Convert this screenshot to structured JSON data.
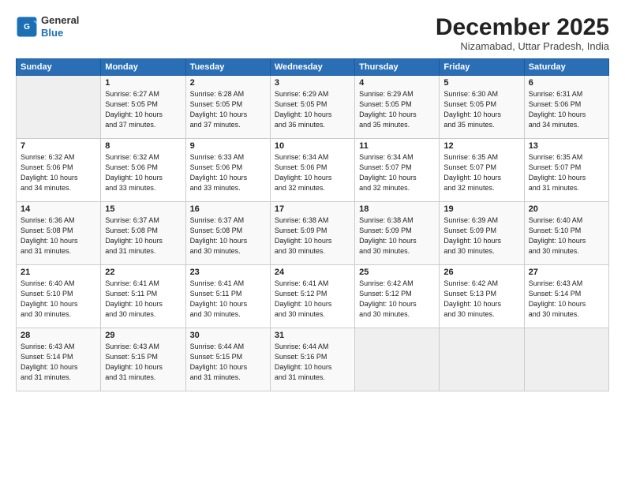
{
  "logo": {
    "line1": "General",
    "line2": "Blue"
  },
  "title": "December 2025",
  "subtitle": "Nizamabad, Uttar Pradesh, India",
  "header_days": [
    "Sunday",
    "Monday",
    "Tuesday",
    "Wednesday",
    "Thursday",
    "Friday",
    "Saturday"
  ],
  "weeks": [
    [
      {
        "day": "",
        "info": ""
      },
      {
        "day": "1",
        "info": "Sunrise: 6:27 AM\nSunset: 5:05 PM\nDaylight: 10 hours\nand 37 minutes."
      },
      {
        "day": "2",
        "info": "Sunrise: 6:28 AM\nSunset: 5:05 PM\nDaylight: 10 hours\nand 37 minutes."
      },
      {
        "day": "3",
        "info": "Sunrise: 6:29 AM\nSunset: 5:05 PM\nDaylight: 10 hours\nand 36 minutes."
      },
      {
        "day": "4",
        "info": "Sunrise: 6:29 AM\nSunset: 5:05 PM\nDaylight: 10 hours\nand 35 minutes."
      },
      {
        "day": "5",
        "info": "Sunrise: 6:30 AM\nSunset: 5:05 PM\nDaylight: 10 hours\nand 35 minutes."
      },
      {
        "day": "6",
        "info": "Sunrise: 6:31 AM\nSunset: 5:06 PM\nDaylight: 10 hours\nand 34 minutes."
      }
    ],
    [
      {
        "day": "7",
        "info": "Sunrise: 6:32 AM\nSunset: 5:06 PM\nDaylight: 10 hours\nand 34 minutes."
      },
      {
        "day": "8",
        "info": "Sunrise: 6:32 AM\nSunset: 5:06 PM\nDaylight: 10 hours\nand 33 minutes."
      },
      {
        "day": "9",
        "info": "Sunrise: 6:33 AM\nSunset: 5:06 PM\nDaylight: 10 hours\nand 33 minutes."
      },
      {
        "day": "10",
        "info": "Sunrise: 6:34 AM\nSunset: 5:06 PM\nDaylight: 10 hours\nand 32 minutes."
      },
      {
        "day": "11",
        "info": "Sunrise: 6:34 AM\nSunset: 5:07 PM\nDaylight: 10 hours\nand 32 minutes."
      },
      {
        "day": "12",
        "info": "Sunrise: 6:35 AM\nSunset: 5:07 PM\nDaylight: 10 hours\nand 32 minutes."
      },
      {
        "day": "13",
        "info": "Sunrise: 6:35 AM\nSunset: 5:07 PM\nDaylight: 10 hours\nand 31 minutes."
      }
    ],
    [
      {
        "day": "14",
        "info": "Sunrise: 6:36 AM\nSunset: 5:08 PM\nDaylight: 10 hours\nand 31 minutes."
      },
      {
        "day": "15",
        "info": "Sunrise: 6:37 AM\nSunset: 5:08 PM\nDaylight: 10 hours\nand 31 minutes."
      },
      {
        "day": "16",
        "info": "Sunrise: 6:37 AM\nSunset: 5:08 PM\nDaylight: 10 hours\nand 30 minutes."
      },
      {
        "day": "17",
        "info": "Sunrise: 6:38 AM\nSunset: 5:09 PM\nDaylight: 10 hours\nand 30 minutes."
      },
      {
        "day": "18",
        "info": "Sunrise: 6:38 AM\nSunset: 5:09 PM\nDaylight: 10 hours\nand 30 minutes."
      },
      {
        "day": "19",
        "info": "Sunrise: 6:39 AM\nSunset: 5:09 PM\nDaylight: 10 hours\nand 30 minutes."
      },
      {
        "day": "20",
        "info": "Sunrise: 6:40 AM\nSunset: 5:10 PM\nDaylight: 10 hours\nand 30 minutes."
      }
    ],
    [
      {
        "day": "21",
        "info": "Sunrise: 6:40 AM\nSunset: 5:10 PM\nDaylight: 10 hours\nand 30 minutes."
      },
      {
        "day": "22",
        "info": "Sunrise: 6:41 AM\nSunset: 5:11 PM\nDaylight: 10 hours\nand 30 minutes."
      },
      {
        "day": "23",
        "info": "Sunrise: 6:41 AM\nSunset: 5:11 PM\nDaylight: 10 hours\nand 30 minutes."
      },
      {
        "day": "24",
        "info": "Sunrise: 6:41 AM\nSunset: 5:12 PM\nDaylight: 10 hours\nand 30 minutes."
      },
      {
        "day": "25",
        "info": "Sunrise: 6:42 AM\nSunset: 5:12 PM\nDaylight: 10 hours\nand 30 minutes."
      },
      {
        "day": "26",
        "info": "Sunrise: 6:42 AM\nSunset: 5:13 PM\nDaylight: 10 hours\nand 30 minutes."
      },
      {
        "day": "27",
        "info": "Sunrise: 6:43 AM\nSunset: 5:14 PM\nDaylight: 10 hours\nand 30 minutes."
      }
    ],
    [
      {
        "day": "28",
        "info": "Sunrise: 6:43 AM\nSunset: 5:14 PM\nDaylight: 10 hours\nand 31 minutes."
      },
      {
        "day": "29",
        "info": "Sunrise: 6:43 AM\nSunset: 5:15 PM\nDaylight: 10 hours\nand 31 minutes."
      },
      {
        "day": "30",
        "info": "Sunrise: 6:44 AM\nSunset: 5:15 PM\nDaylight: 10 hours\nand 31 minutes."
      },
      {
        "day": "31",
        "info": "Sunrise: 6:44 AM\nSunset: 5:16 PM\nDaylight: 10 hours\nand 31 minutes."
      },
      {
        "day": "",
        "info": ""
      },
      {
        "day": "",
        "info": ""
      },
      {
        "day": "",
        "info": ""
      }
    ]
  ]
}
